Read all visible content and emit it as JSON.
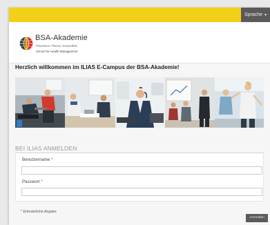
{
  "topbar": {
    "language_label": "Sprache",
    "accent": "#f2d01a"
  },
  "brand": {
    "name": "BSA-Akademie",
    "subtitle": "Prävention, Fitness, Gesundheit",
    "tagline": "School for Health Management",
    "logo_icon": "globe-logo-icon"
  },
  "welcome_heading": "Herzlich willkommen im ILIAS E-Campus der BSA-Akademie!",
  "banner": {
    "photos": [
      "fitness-training-photo",
      "office-meeting-photo",
      "call-center-photo",
      "presentation-photo",
      "fitness-class-photo"
    ]
  },
  "login": {
    "section_title": "BEI ILIAS ANMELDEN",
    "username_label": "Benutzername",
    "username_value": "",
    "password_label": "Passwort",
    "password_value": "",
    "required_marker": "*",
    "required_note": "Erforderliche Angabe",
    "submit_label": "Anmelden"
  }
}
